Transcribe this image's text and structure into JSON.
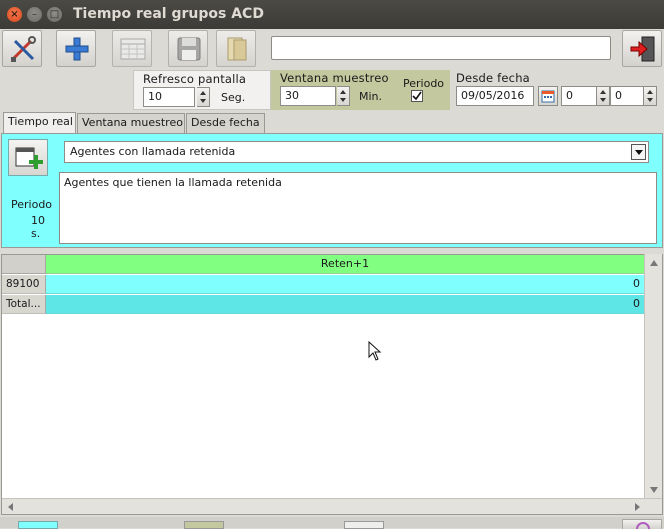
{
  "window": {
    "title": "Tiempo real grupos ACD",
    "close_glyph": "×",
    "min_glyph": "–",
    "max_glyph": "□"
  },
  "toolbar": {
    "buttons": [
      {
        "icon": "tools-icon"
      },
      {
        "icon": "add-icon"
      },
      {
        "icon": "calendar-grid-icon"
      },
      {
        "icon": "save-icon"
      },
      {
        "icon": "folder-icon"
      }
    ],
    "search_value": "",
    "exit_icon": "exit-door-icon"
  },
  "params": {
    "refresh": {
      "label": "Refresco pantalla",
      "value": "10",
      "unit": "Seg."
    },
    "window": {
      "label": "Ventana muestreo",
      "value": "30",
      "unit": "Min.",
      "period_label": "Periodo",
      "period_checked": true
    },
    "since": {
      "label": "Desde fecha",
      "date": "09/05/2016",
      "hour": "0",
      "minute": "0"
    }
  },
  "tabs": [
    {
      "label": "Tiempo real",
      "active": true
    },
    {
      "label": "Ventana muestreo",
      "active": false
    },
    {
      "label": "Desde fecha",
      "active": false
    }
  ],
  "panel": {
    "period_label": "Periodo",
    "period_value": "10 s.",
    "combo_value": "Agentes con llamada retenida",
    "description": "Agentes que tienen la llamada retenida"
  },
  "grid": {
    "columns": [
      "Reten+1"
    ],
    "rows": [
      {
        "head": "89100",
        "values": [
          "0"
        ]
      },
      {
        "head": "Total...",
        "values": [
          "0"
        ]
      }
    ]
  },
  "colors": {
    "panel_bg": "#80ffff",
    "header_bg": "#80ff80",
    "accent_orange": "#e8592b"
  }
}
